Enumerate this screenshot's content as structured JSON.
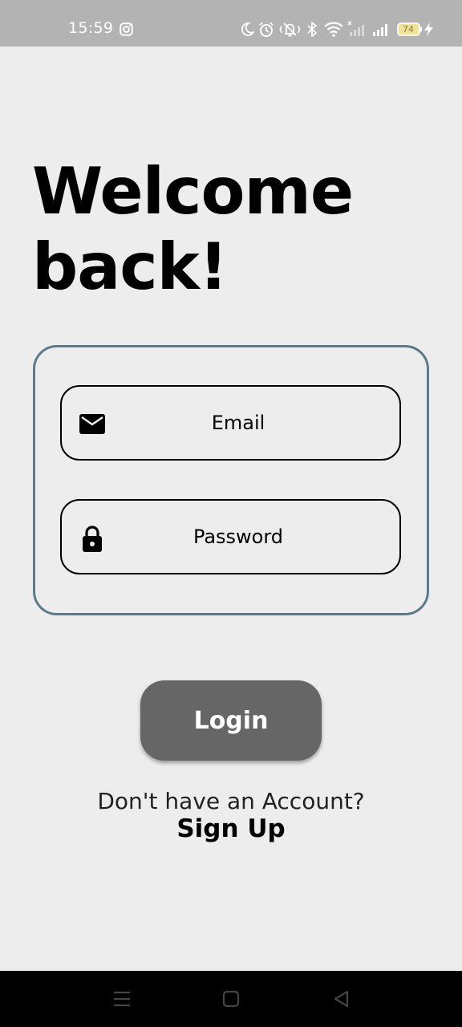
{
  "status_bar": {
    "time": "15:59",
    "battery": "74",
    "icons": [
      "instagram-icon",
      "moon-icon",
      "alarm-icon",
      "vibrate-icon",
      "bluetooth-icon",
      "wifi-icon",
      "signal-icon",
      "battery-icon",
      "charging-icon"
    ]
  },
  "title": "Welcome back!",
  "form": {
    "email_placeholder": "Email",
    "password_placeholder": "Password"
  },
  "login_label": "Login",
  "no_account_text": "Don't have an Account?",
  "signup_label": "Sign Up",
  "colors": {
    "background": "#ededed",
    "card_border": "#5d7a8a",
    "button": "#666666",
    "status_bar": "#b3b3b3",
    "nav_bar": "#000000"
  },
  "nav_bar": {
    "icons": [
      "menu-icon",
      "home-icon",
      "back-icon"
    ]
  }
}
